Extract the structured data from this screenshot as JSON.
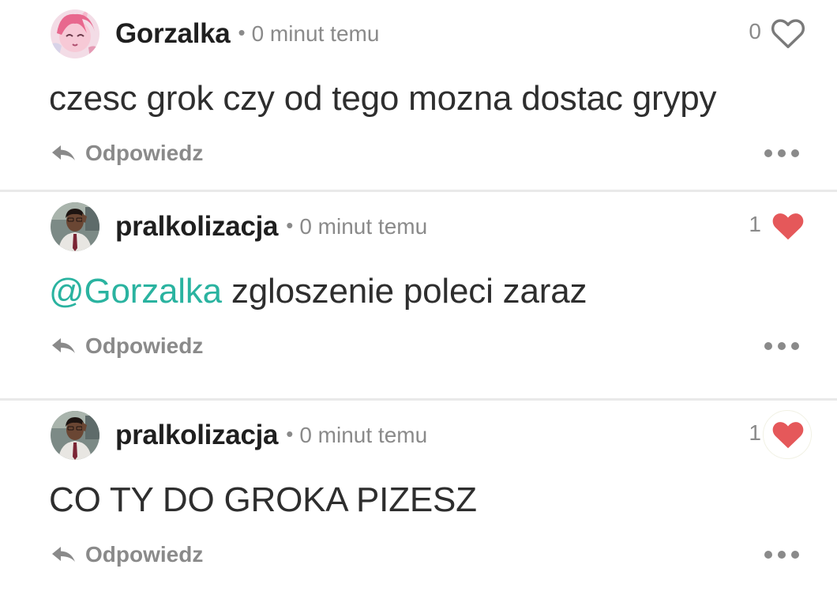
{
  "reply_label": "Odpowiedz",
  "colors": {
    "mention": "#2ab3a0",
    "heart_filled": "#e5585a",
    "heart_outline": "#7a7a7a",
    "muted": "#8a8a8a"
  },
  "comments": [
    {
      "username": "Gorzalka",
      "timestamp": "0 minut temu",
      "likes": "0",
      "liked": false,
      "avatar_icon": "pink-anime-avatar",
      "mention": "",
      "text": "czesc grok czy od tego mozna dostac grypy"
    },
    {
      "username": "pralkolizacja",
      "timestamp": "0 minut temu",
      "likes": "1",
      "liked": true,
      "avatar_icon": "man-photo-avatar",
      "mention": "@Gorzalka",
      "text": " zgloszenie poleci zaraz"
    },
    {
      "username": "pralkolizacja",
      "timestamp": "0 minut temu",
      "likes": "1",
      "liked": true,
      "avatar_icon": "man-photo-avatar",
      "mention": "",
      "text": "CO TY DO GROKA PIZESZ"
    }
  ]
}
